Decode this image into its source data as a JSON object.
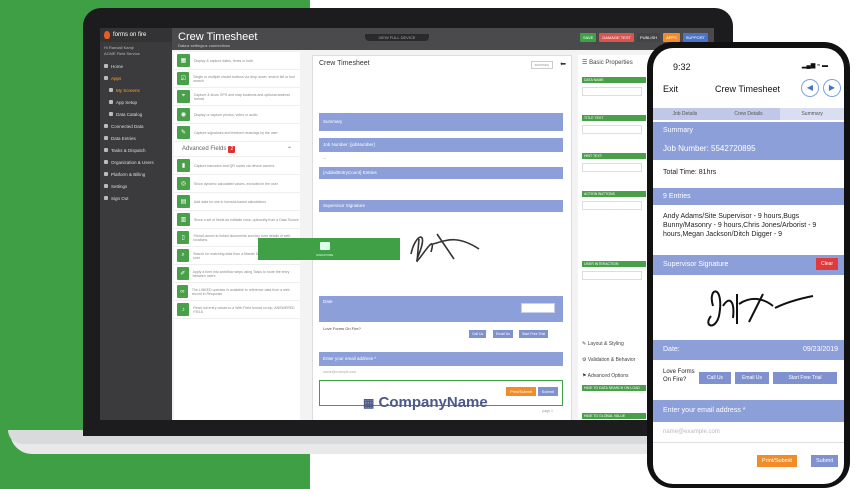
{
  "sidebar": {
    "brand": "forms on fire",
    "user_name": "Hi Randall Kamji",
    "user_org": "ACME Field Service",
    "items": [
      {
        "label": "Home",
        "active": false
      },
      {
        "label": "Apps",
        "active": true
      },
      {
        "label": "My Screens",
        "active": true,
        "sub": true
      },
      {
        "label": "App Setup",
        "active": false,
        "sub": true
      },
      {
        "label": "Data Catalog",
        "active": false,
        "sub": true
      },
      {
        "label": "Connected Data",
        "active": false
      },
      {
        "label": "Data Entries",
        "active": false
      },
      {
        "label": "Tasks & Dispatch",
        "active": false
      },
      {
        "label": "Organization & Users",
        "active": false
      },
      {
        "label": "Platform & Billing",
        "active": false
      },
      {
        "label": "Settings",
        "active": false
      },
      {
        "label": "Sign Out",
        "active": false
      }
    ]
  },
  "header": {
    "title": "Crew Timesheet",
    "breadcrumb": "Data ▸ settings ▸ connections",
    "notch": "VIEW FULL DEVICE",
    "buttons": [
      {
        "label": "SAVE",
        "color": "#3fa046"
      },
      {
        "label": "DAMAGE TEST",
        "color": "#d9534f"
      },
      {
        "label": "PUBLISH",
        "color": "#444444"
      },
      {
        "label": "APPS",
        "color": "#f28c28"
      },
      {
        "label": "SUPPORT",
        "color": "#4b74c9"
      }
    ]
  },
  "fields_panel": {
    "basic_fields": [
      {
        "icon": "calendar-icon",
        "desc": "Display & capture dates, times or both"
      },
      {
        "icon": "checklist-icon",
        "desc": "Single or multiple choice buttons via drop down, search list or tool search"
      },
      {
        "icon": "location-pin-icon",
        "desc": "Capture & show GPS and map locations and optional address format"
      },
      {
        "icon": "camera-icon",
        "desc": "Display or capture photos, video or audio"
      },
      {
        "icon": "pen-icon",
        "desc": "Capture signatures and freeform drawings by the user"
      }
    ],
    "advanced_heading": "Advanced Fields",
    "advanced_badge": "2",
    "advanced_fields": [
      {
        "icon": "barcode-icon",
        "desc": "Capture barcodes and QR codes via device camera"
      },
      {
        "icon": "eye-icon",
        "desc": "Show dynamic calculated values, excluded in the user"
      },
      {
        "icon": "calculator-icon",
        "desc": "Add data for use in formula-based calculations"
      },
      {
        "icon": "table-icon",
        "desc": "Show a set of fields as editable rows, optionally from a Data Source"
      },
      {
        "icon": "document-icon",
        "desc": "Show/Launch to linked documents and key form details of web locations"
      },
      {
        "icon": "search-icon",
        "desc": "Search for matching data from a Master Data Source available to the user"
      },
      {
        "icon": "sketch-icon",
        "desc": "Apply a form into workflow steps using Tasks to route the entry between users"
      },
      {
        "icon": "link-icon",
        "desc": "The LINKED operator is available to reference data from a web record in Response"
      },
      {
        "icon": "speaker-icon",
        "desc": "Read out entry values to a Web Field format on top, ANSWERED FIELD"
      }
    ]
  },
  "builder": {
    "title": "Crew Timesheet",
    "selector": "summary",
    "summary": "Summary",
    "job_number": "Job Number: {jobNumber}",
    "entries": "{AddedEntryCount} Entries",
    "supervisor_signature": "Supervisor Signature",
    "date_label": "Date",
    "love_forms": "Love Forms On Fire?",
    "call_us": "Call Us",
    "email_us": "Email Us",
    "start_trial": "Start Free Trial",
    "email_prompt": "Enter your email address *",
    "email_placeholder": "name@example.com",
    "print_submit": "Print/Submit",
    "submit": "Submit",
    "page_hint": "page 1",
    "company_name": "CompanyName",
    "drag_label": "SIGNATURE"
  },
  "properties": {
    "title": "Basic Properties",
    "sections": [
      "DATA NAME",
      "TITLE TEXT",
      "HINT TEXT",
      "ACTION BUTTONS",
      "USER INTERACTION"
    ],
    "layout_styling": "Layout & Styling",
    "validation": "Validation & Behavior",
    "advanced_options": "Advanced Options",
    "labels": [
      "HIDE TO DATA SEARCH ON LOAD",
      "HIDE TO GLOBAL VALUE"
    ]
  },
  "phone": {
    "time": "9:32",
    "status": "▂▄▆ ≈ ▬",
    "exit": "Exit",
    "title": "Crew Timesheet",
    "tabs": [
      "Job Details",
      "Crew Details",
      "Summary"
    ],
    "summary": "Summary",
    "job_number": "Job Number: 5542720895",
    "total_time": "Total Time: 81hrs",
    "entries_title": "9 Entries",
    "entries_text": "Andy Adams/Site Supervisor - 9 hours,Bugs Bunny/Masonry - 9 hours,Chris Jones/Arborist - 9 hours,Megan Jackson/Ditch Digger - 9",
    "supervisor_signature": "Supervisor Signature",
    "clear": "Clear",
    "date_label": "Date:",
    "date_value": "09/23/2019",
    "love_forms": "Love Forms On Fire?",
    "call_us": "Call Us",
    "email_us": "Email Us",
    "start_trial": "Start Free Trial",
    "email_prompt": "Enter your email address *",
    "email_placeholder": "name@example.com",
    "print_submit": "Print/Submit",
    "submit": "Submit"
  },
  "colors": {
    "green": "#3f9f45",
    "band": "#8d9fd8",
    "orange": "#f28c28",
    "red": "#e03a3a"
  }
}
